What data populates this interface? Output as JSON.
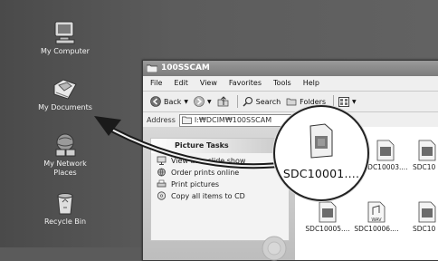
{
  "desktop": {
    "icons": [
      {
        "label": "My Computer",
        "icon": "my-computer-icon"
      },
      {
        "label": "My Documents",
        "icon": "my-documents-icon"
      },
      {
        "label": "My Network\nPlaces",
        "line1": "My Network",
        "line2": "Places",
        "icon": "network-places-icon"
      },
      {
        "label": "Recycle Bin",
        "icon": "recycle-bin-icon"
      }
    ]
  },
  "window": {
    "title": "100SSCAM",
    "menu": [
      "File",
      "Edit",
      "View",
      "Favorites",
      "Tools",
      "Help"
    ],
    "toolbar": {
      "back_label": "Back",
      "search_label": "Search",
      "folders_label": "Folders"
    },
    "address": {
      "label": "Address",
      "path": "I:₩DCIM₩100SSCAM"
    },
    "task_pane": {
      "heading": "Picture Tasks",
      "tasks": [
        "View as a slide show",
        "Order prints online",
        "Print pictures",
        "Copy all items to CD"
      ]
    },
    "files": [
      {
        "name": "SDC10003....",
        "icon": "image-file-icon"
      },
      {
        "name": "SDC10",
        "icon": "image-file-icon"
      },
      {
        "name": "SDC10005....",
        "icon": "image-file-icon"
      },
      {
        "name": "SDC10006....",
        "icon": "wav-file-icon",
        "badge": "WAV"
      },
      {
        "name": "SDC10",
        "icon": "image-file-icon"
      }
    ],
    "zoom_item": {
      "name": "SDC10001....",
      "icon": "image-file-icon"
    }
  },
  "colors": {
    "desktop": "#5b5b5b",
    "titlebar": "#8a8a8a",
    "arrow": "#1a1a1a"
  }
}
